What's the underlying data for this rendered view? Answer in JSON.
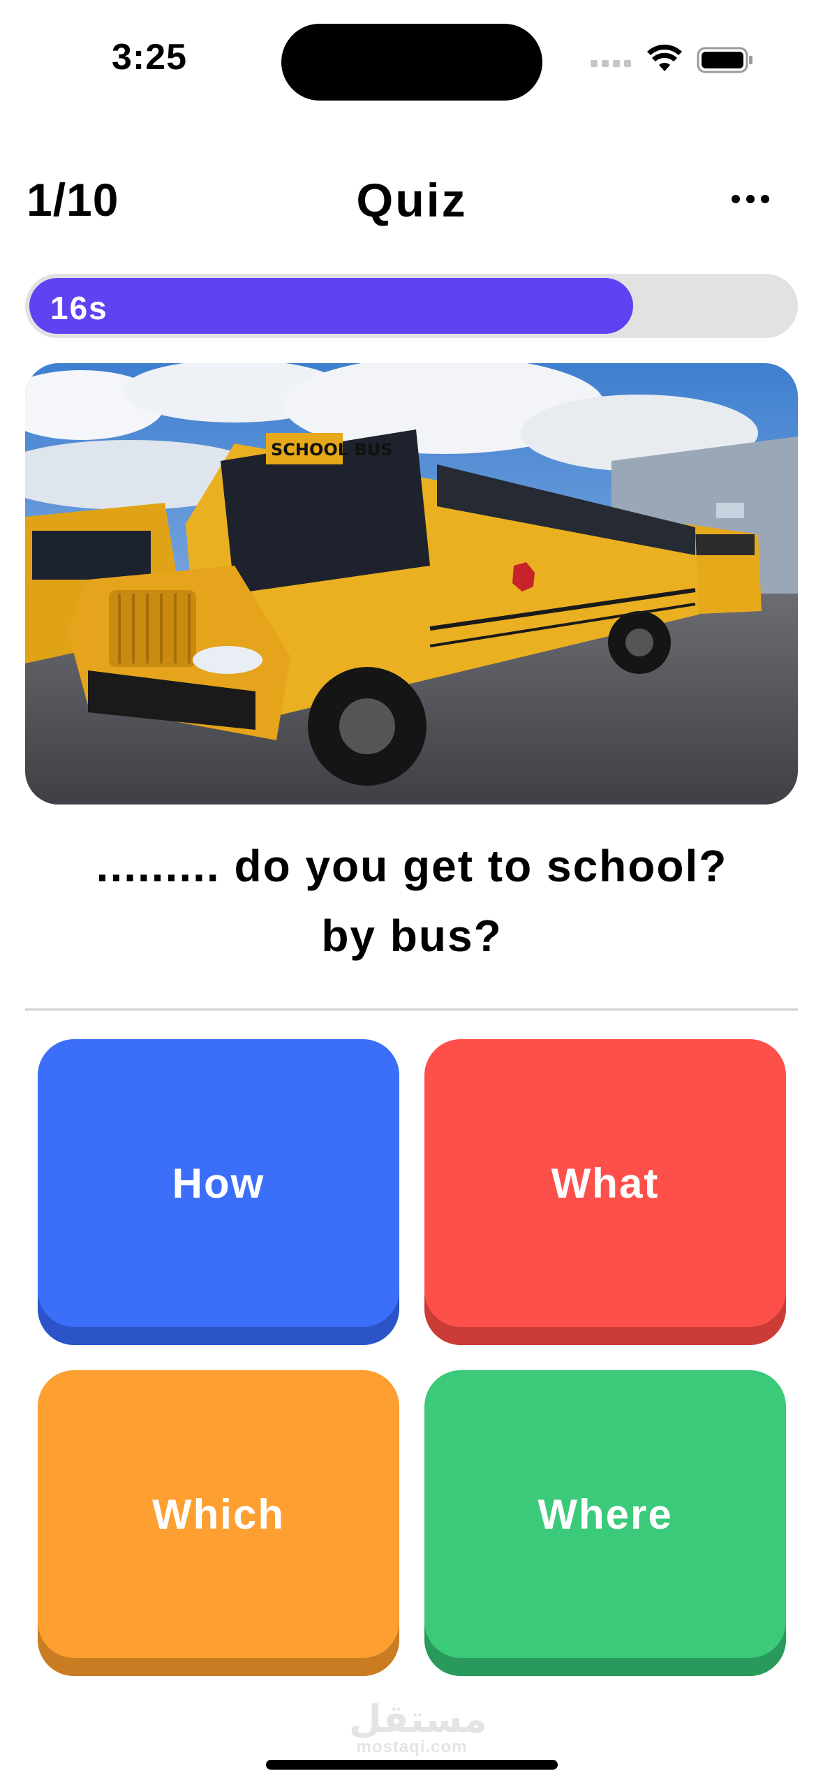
{
  "status_bar": {
    "time": "3:25",
    "icons": [
      "cellular-signal-icon",
      "wifi-icon",
      "battery-icon"
    ]
  },
  "header": {
    "counter": "1/10",
    "title": "Quiz",
    "menu_icon": "more-horizontal-icon"
  },
  "timer": {
    "label": "16s",
    "progress_fraction": 0.79,
    "fill_color": "#5e43f3",
    "track_color": "#e2e2e2"
  },
  "question": {
    "line1": "......... do you get to school?",
    "line2": "by bus?"
  },
  "answers": [
    {
      "label": "How",
      "color": "#3b6ef9"
    },
    {
      "label": "What",
      "color": "#fe504b"
    },
    {
      "label": "Which",
      "color": "#fd9f31"
    },
    {
      "label": "Where",
      "color": "#3bc97a"
    }
  ],
  "watermark": {
    "arabic": "مستقل",
    "latin": "mostaqi.com"
  }
}
